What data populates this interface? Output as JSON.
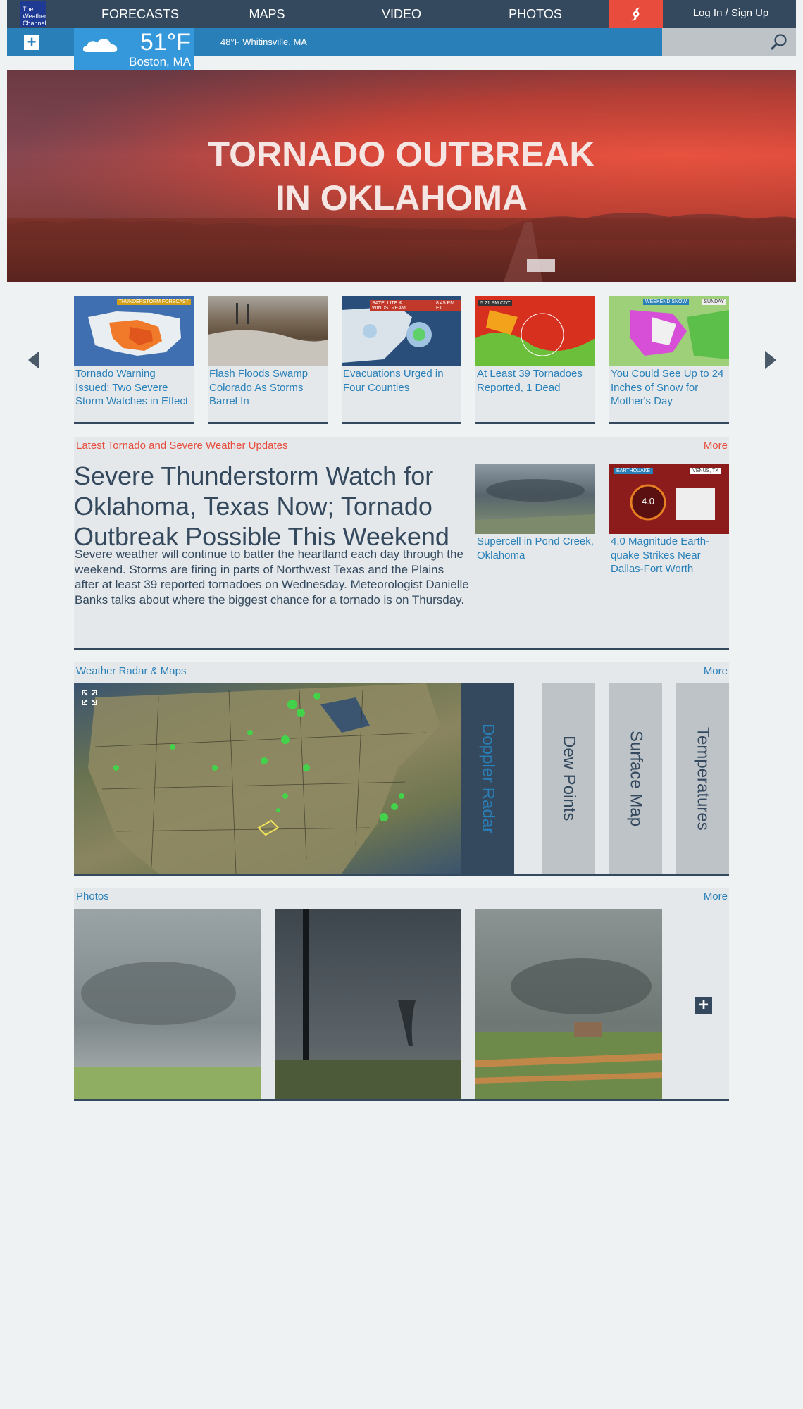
{
  "nav": {
    "logo_text": "The Weather Channel",
    "items": [
      "FORECASTS",
      "MAPS",
      "VIDEO",
      "PHOTOS"
    ],
    "login_label": "Log In / Sign Up"
  },
  "current": {
    "temp": "51°F",
    "city": "Boston, MA",
    "nearby": "48°F Whitinsville, MA"
  },
  "hero": {
    "title_line1": "TORNADO OUTBREAK",
    "title_line2": "IN OKLAHOMA"
  },
  "carousel": {
    "cards": [
      {
        "caption": "Tornado Warning Issued; Two Severe Storm Watches in Effect",
        "thumb_tag": "THUNDERSTORM FORECAST"
      },
      {
        "caption": "Flash Floods Swamp Colorado As Storms Barrel In",
        "thumb_tag": ""
      },
      {
        "caption": "Evacuations Urged in Four Counties",
        "thumb_tag": "SATELLITE & WINDSTREAM",
        "thumb_time": "8:45 PM ET"
      },
      {
        "caption": "At Least 39 Tornadoes Reported, 1 Dead",
        "thumb_tag": "5:21 PM CDT"
      },
      {
        "caption": "You Could See Up to 24 Inches of Snow for Mother's Day",
        "thumb_tag": "WEEKEND SNOW",
        "thumb_day": "SUNDAY"
      }
    ]
  },
  "latest": {
    "title": "Latest Tornado and Severe Weather Updates",
    "more": "More",
    "headline": "Severe Thunderstorm Watch for Oklahoma, Texas Now; Tornado Outbreak Possible This Weekend",
    "summary": "Severe weather will continue to batter the heartland each day through the weekend. Storms are firing in parts of Northwest Texas and the Plains after at least 39 reported tornadoes on Wednesday. Meteorologist Danielle Banks talks about where the biggest chance for a tornado is on Thursday.",
    "side": [
      {
        "caption": "Supercell in Pond Creek, Oklahoma"
      },
      {
        "caption": "4.0 Magnitude Earth-quake Strikes Near Dallas-Fort Worth",
        "thumb_tag": "EARTHQUAKE",
        "thumb_loc": "VENUS, TX",
        "thumb_mag": "4.0"
      }
    ]
  },
  "radar": {
    "title": "Weather Radar & Maps",
    "more": "More",
    "tabs": [
      "Doppler Radar",
      "Dew Points",
      "Surface Map",
      "Temperatures"
    ]
  },
  "photos": {
    "title": "Photos",
    "more": "More"
  },
  "colors": {
    "nav_bg": "#34495e",
    "accent_blue": "#2980b9",
    "alert_red": "#e74c3c",
    "tab_grey": "#bdc3c7"
  }
}
